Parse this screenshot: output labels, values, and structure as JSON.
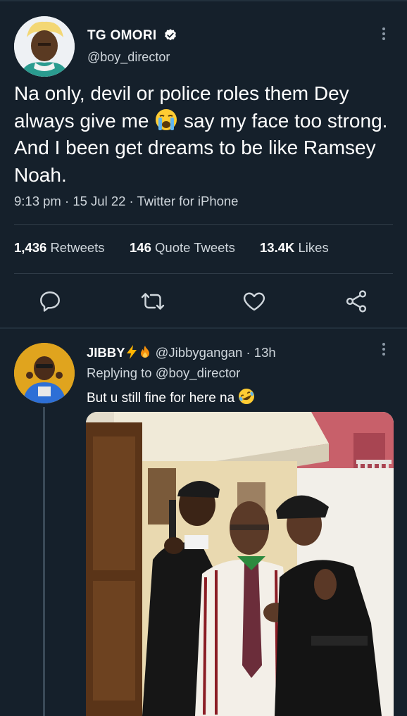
{
  "tweet": {
    "author_name": "TG OMORI",
    "author_handle": "@boy_director",
    "text_part1": "Na only, devil or police roles them Dey always give me ",
    "text_part2": " say my face too strong.  And I been get dreams to be like Ramsey Noah.",
    "inline_emoji": "loudly-crying-face",
    "time": "9:13 pm",
    "date": "15 Jul 22",
    "source": "Twitter for iPhone",
    "retweets_count": "1,436",
    "retweets_label": "Retweets",
    "quote_count": "146",
    "quote_label": "Quote Tweets",
    "likes_count": "13.4K",
    "likes_label": "Likes",
    "icons": {
      "verified": "verified-badge-icon",
      "more": "more-options-icon",
      "reply": "reply-icon",
      "retweet": "retweet-icon",
      "like": "heart-icon",
      "share": "share-icon"
    }
  },
  "reply": {
    "author_name": "JIBBY",
    "name_emojis": [
      "high-voltage",
      "fire"
    ],
    "author_handle": "@Jibbygangan",
    "time_ago": "13h",
    "replying_prefix": "Replying to ",
    "replying_to": "@boy_director",
    "text": "But u still fine for here na ",
    "text_emoji": "rolling-on-the-floor-laughing",
    "image": "photo of three people in police uniforms posing in front of a building"
  },
  "colors": {
    "background": "#15202b",
    "text": "#ffffff",
    "secondary": "#cfd6dc",
    "divider": "#2f3b47",
    "verified": "#ffffff"
  }
}
